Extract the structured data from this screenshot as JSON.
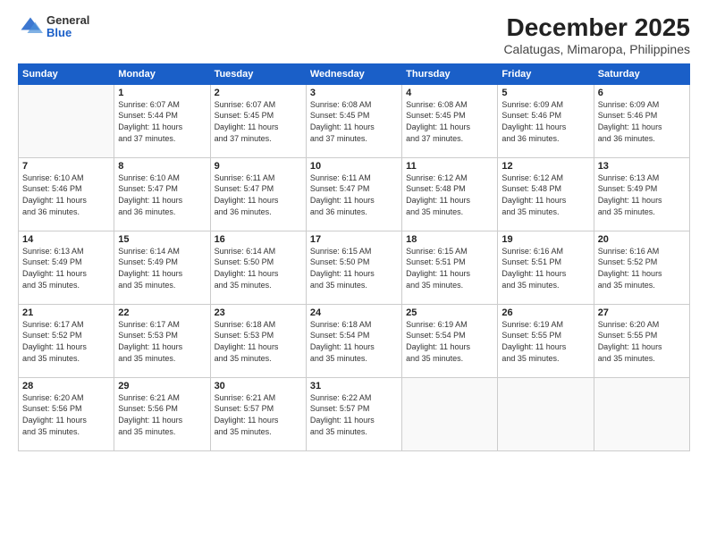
{
  "logo": {
    "general": "General",
    "blue": "Blue"
  },
  "title": "December 2025",
  "subtitle": "Calatugas, Mimaropa, Philippines",
  "weekdays": [
    "Sunday",
    "Monday",
    "Tuesday",
    "Wednesday",
    "Thursday",
    "Friday",
    "Saturday"
  ],
  "weeks": [
    [
      {
        "day": "",
        "sunrise": "",
        "sunset": "",
        "daylight": ""
      },
      {
        "day": "1",
        "sunrise": "6:07 AM",
        "sunset": "5:44 PM",
        "daylight": "11 hours and 37 minutes."
      },
      {
        "day": "2",
        "sunrise": "6:07 AM",
        "sunset": "5:45 PM",
        "daylight": "11 hours and 37 minutes."
      },
      {
        "day": "3",
        "sunrise": "6:08 AM",
        "sunset": "5:45 PM",
        "daylight": "11 hours and 37 minutes."
      },
      {
        "day": "4",
        "sunrise": "6:08 AM",
        "sunset": "5:45 PM",
        "daylight": "11 hours and 37 minutes."
      },
      {
        "day": "5",
        "sunrise": "6:09 AM",
        "sunset": "5:46 PM",
        "daylight": "11 hours and 36 minutes."
      },
      {
        "day": "6",
        "sunrise": "6:09 AM",
        "sunset": "5:46 PM",
        "daylight": "11 hours and 36 minutes."
      }
    ],
    [
      {
        "day": "7",
        "sunrise": "6:10 AM",
        "sunset": "5:46 PM",
        "daylight": "11 hours and 36 minutes."
      },
      {
        "day": "8",
        "sunrise": "6:10 AM",
        "sunset": "5:47 PM",
        "daylight": "11 hours and 36 minutes."
      },
      {
        "day": "9",
        "sunrise": "6:11 AM",
        "sunset": "5:47 PM",
        "daylight": "11 hours and 36 minutes."
      },
      {
        "day": "10",
        "sunrise": "6:11 AM",
        "sunset": "5:47 PM",
        "daylight": "11 hours and 36 minutes."
      },
      {
        "day": "11",
        "sunrise": "6:12 AM",
        "sunset": "5:48 PM",
        "daylight": "11 hours and 35 minutes."
      },
      {
        "day": "12",
        "sunrise": "6:12 AM",
        "sunset": "5:48 PM",
        "daylight": "11 hours and 35 minutes."
      },
      {
        "day": "13",
        "sunrise": "6:13 AM",
        "sunset": "5:49 PM",
        "daylight": "11 hours and 35 minutes."
      }
    ],
    [
      {
        "day": "14",
        "sunrise": "6:13 AM",
        "sunset": "5:49 PM",
        "daylight": "11 hours and 35 minutes."
      },
      {
        "day": "15",
        "sunrise": "6:14 AM",
        "sunset": "5:49 PM",
        "daylight": "11 hours and 35 minutes."
      },
      {
        "day": "16",
        "sunrise": "6:14 AM",
        "sunset": "5:50 PM",
        "daylight": "11 hours and 35 minutes."
      },
      {
        "day": "17",
        "sunrise": "6:15 AM",
        "sunset": "5:50 PM",
        "daylight": "11 hours and 35 minutes."
      },
      {
        "day": "18",
        "sunrise": "6:15 AM",
        "sunset": "5:51 PM",
        "daylight": "11 hours and 35 minutes."
      },
      {
        "day": "19",
        "sunrise": "6:16 AM",
        "sunset": "5:51 PM",
        "daylight": "11 hours and 35 minutes."
      },
      {
        "day": "20",
        "sunrise": "6:16 AM",
        "sunset": "5:52 PM",
        "daylight": "11 hours and 35 minutes."
      }
    ],
    [
      {
        "day": "21",
        "sunrise": "6:17 AM",
        "sunset": "5:52 PM",
        "daylight": "11 hours and 35 minutes."
      },
      {
        "day": "22",
        "sunrise": "6:17 AM",
        "sunset": "5:53 PM",
        "daylight": "11 hours and 35 minutes."
      },
      {
        "day": "23",
        "sunrise": "6:18 AM",
        "sunset": "5:53 PM",
        "daylight": "11 hours and 35 minutes."
      },
      {
        "day": "24",
        "sunrise": "6:18 AM",
        "sunset": "5:54 PM",
        "daylight": "11 hours and 35 minutes."
      },
      {
        "day": "25",
        "sunrise": "6:19 AM",
        "sunset": "5:54 PM",
        "daylight": "11 hours and 35 minutes."
      },
      {
        "day": "26",
        "sunrise": "6:19 AM",
        "sunset": "5:55 PM",
        "daylight": "11 hours and 35 minutes."
      },
      {
        "day": "27",
        "sunrise": "6:20 AM",
        "sunset": "5:55 PM",
        "daylight": "11 hours and 35 minutes."
      }
    ],
    [
      {
        "day": "28",
        "sunrise": "6:20 AM",
        "sunset": "5:56 PM",
        "daylight": "11 hours and 35 minutes."
      },
      {
        "day": "29",
        "sunrise": "6:21 AM",
        "sunset": "5:56 PM",
        "daylight": "11 hours and 35 minutes."
      },
      {
        "day": "30",
        "sunrise": "6:21 AM",
        "sunset": "5:57 PM",
        "daylight": "11 hours and 35 minutes."
      },
      {
        "day": "31",
        "sunrise": "6:22 AM",
        "sunset": "5:57 PM",
        "daylight": "11 hours and 35 minutes."
      },
      {
        "day": "",
        "sunrise": "",
        "sunset": "",
        "daylight": ""
      },
      {
        "day": "",
        "sunrise": "",
        "sunset": "",
        "daylight": ""
      },
      {
        "day": "",
        "sunrise": "",
        "sunset": "",
        "daylight": ""
      }
    ]
  ],
  "labels": {
    "sunrise": "Sunrise:",
    "sunset": "Sunset:",
    "daylight": "Daylight:"
  }
}
